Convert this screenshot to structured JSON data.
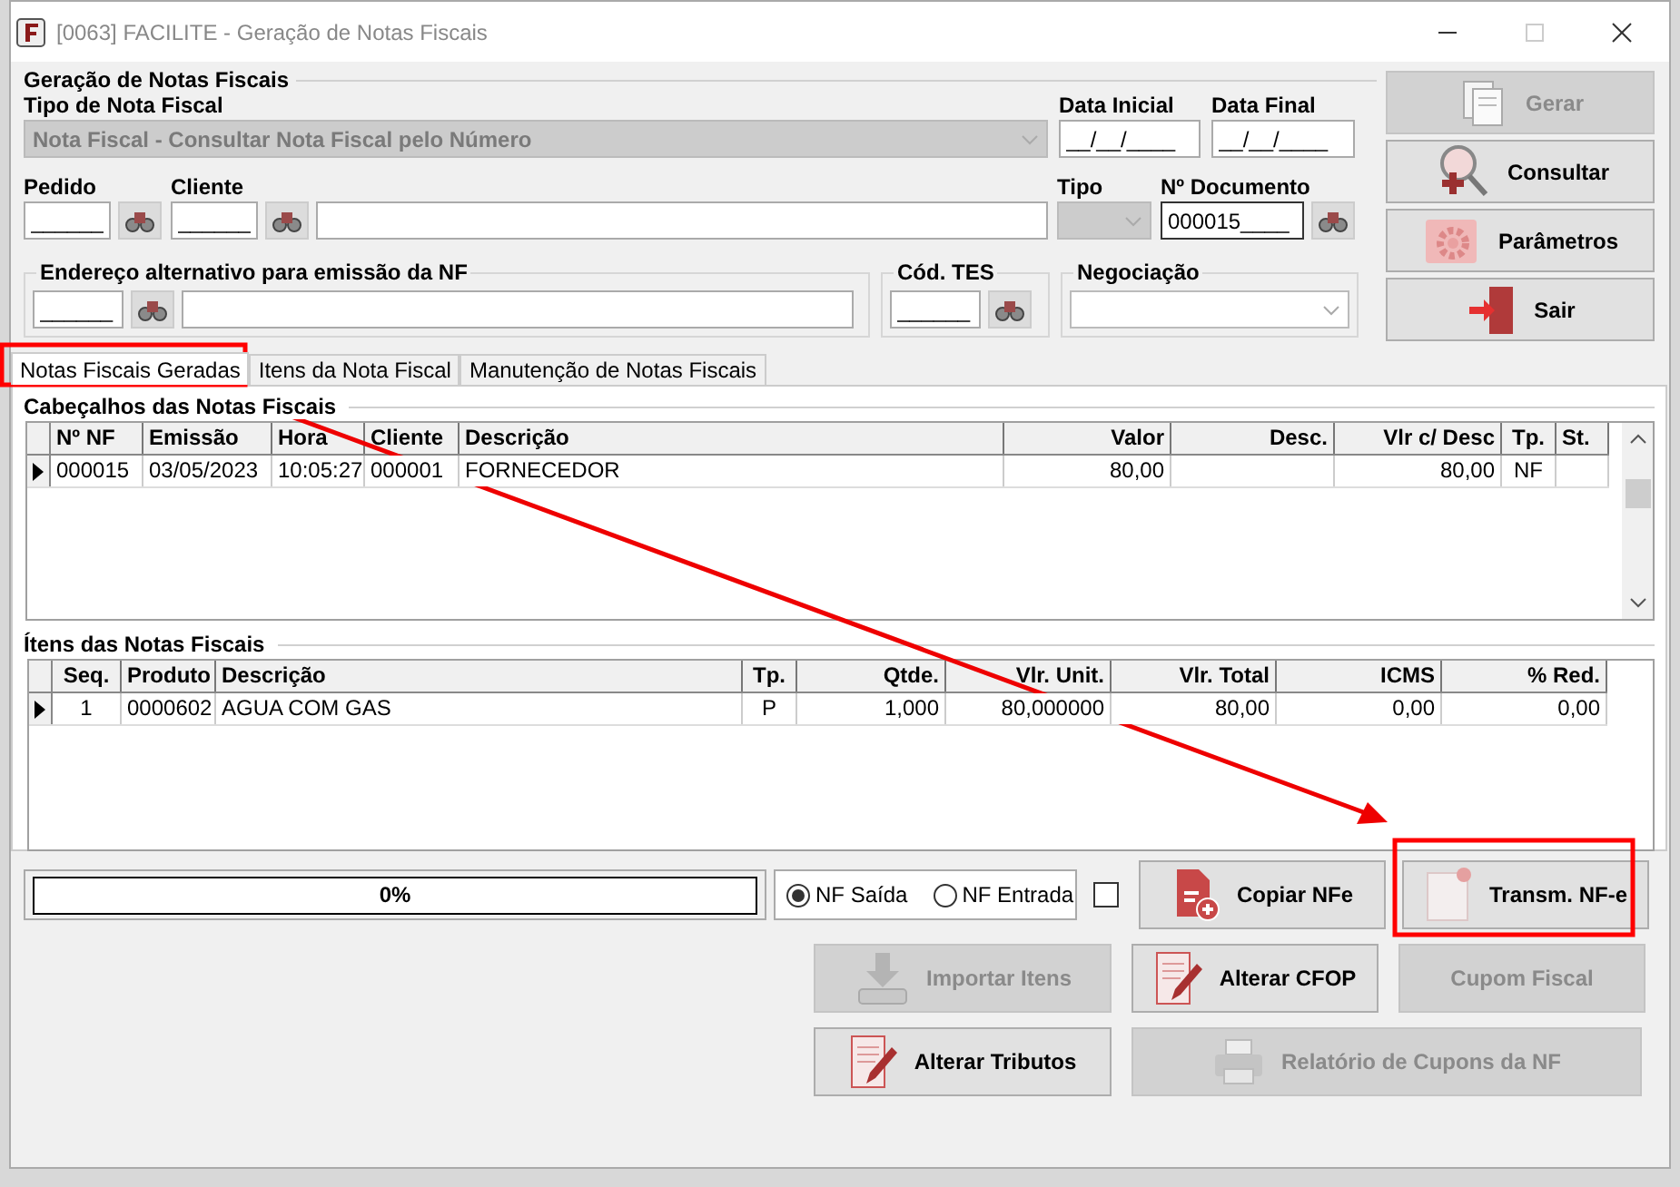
{
  "window": {
    "title": "[0063] FACILITE - Geração de Notas Fiscais"
  },
  "form": {
    "group_title": "Geração de Notas Fiscais",
    "tipo_nota": {
      "label": "Tipo de Nota Fiscal",
      "value": "Nota Fiscal - Consultar Nota Fiscal pelo Número",
      "disabled": true
    },
    "data_inicial": {
      "label": "Data Inicial",
      "value": "__/__/____"
    },
    "data_final": {
      "label": "Data Final",
      "value": "__/__/____"
    },
    "pedido": {
      "label": "Pedido",
      "value": "______"
    },
    "cliente": {
      "label": "Cliente",
      "value": "______"
    },
    "tipo": {
      "label": "Tipo",
      "disabled": true
    },
    "documento": {
      "label": "Nº Documento",
      "value": "000015____"
    },
    "endereco": {
      "label": "Endereço alternativo para emissão da NF",
      "value": "______"
    },
    "cod_tes": {
      "label": "Cód. TES",
      "value": "______"
    },
    "negociacao": {
      "label": "Negociação"
    }
  },
  "side_buttons": [
    {
      "label": "Gerar",
      "disabled": true
    },
    {
      "label": "Consultar",
      "disabled": false
    },
    {
      "label": "Parâmetros",
      "disabled": false
    },
    {
      "label": "Sair",
      "disabled": false
    }
  ],
  "tabs": [
    {
      "label": "Notas Fiscais Geradas",
      "selected": true
    },
    {
      "label": "Itens da Nota Fiscal",
      "selected": false
    },
    {
      "label": "Manutenção de Notas Fiscais",
      "selected": false
    }
  ],
  "grids": [
    {
      "title": "Cabeçalhos das Notas Fiscais",
      "columns": [
        "Nº NF",
        "Emissão",
        "Hora",
        "Cliente",
        "Descrição",
        "Valor",
        "Desc.",
        "Vlr c/ Desc",
        "Tp.",
        "St."
      ],
      "rows": [
        {
          "selected": true,
          "cells": [
            "000015",
            "03/05/2023",
            "10:05:27",
            "000001",
            "FORNECEDOR",
            "80,00",
            null,
            "80,00",
            "NF",
            null
          ]
        }
      ]
    },
    {
      "title": "Ítens das Notas Fiscais",
      "columns": [
        "Seq.",
        "Produto",
        "Descrição",
        "Tp.",
        "Qtde.",
        "Vlr. Unit.",
        "Vlr. Total",
        "ICMS",
        "% Red."
      ],
      "rows": [
        {
          "selected": true,
          "cells": [
            "1",
            "0000602",
            "AGUA COM GAS",
            "P",
            "1,000",
            "80,000000",
            "80,00",
            "0,00",
            "0,00"
          ]
        }
      ]
    }
  ],
  "progress": {
    "level": 0,
    "text": "0%"
  },
  "radios": [
    {
      "label": "NF Saída",
      "selected": true
    },
    {
      "label": "NF Entrada",
      "selected": false
    }
  ],
  "checkbox": {
    "checked": false
  },
  "action_buttons": [
    {
      "label": "Copiar NFe",
      "disabled": false
    },
    {
      "label": "Transm. NF-e",
      "disabled": false
    },
    {
      "label": "Importar Itens",
      "disabled": true
    },
    {
      "label": "Alterar CFOP",
      "disabled": false
    },
    {
      "label": "Cupom Fiscal",
      "disabled": true
    },
    {
      "label": "Alterar Tributos",
      "disabled": false
    },
    {
      "label": "Relatório de Cupons da NF",
      "disabled": true
    }
  ]
}
